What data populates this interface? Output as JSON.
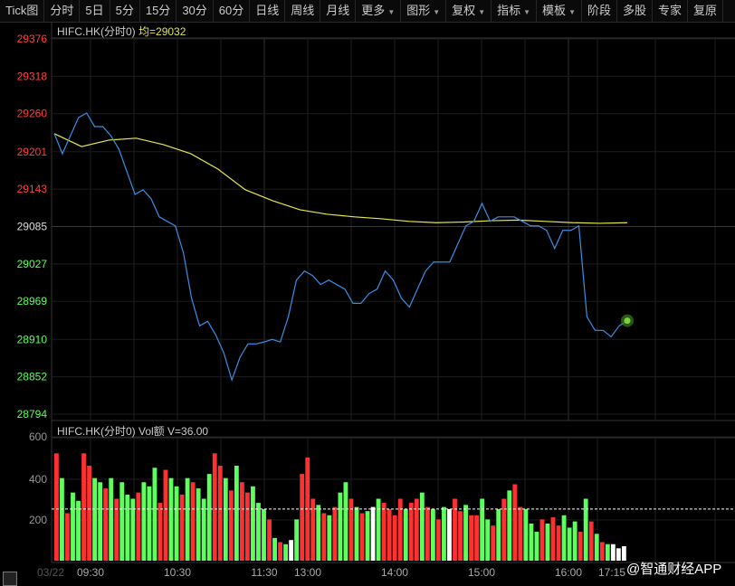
{
  "toolbar": [
    {
      "label": "Tick图",
      "dd": false
    },
    {
      "label": "分时",
      "dd": false
    },
    {
      "label": "5日",
      "dd": false
    },
    {
      "label": "5分",
      "dd": false
    },
    {
      "label": "15分",
      "dd": false
    },
    {
      "label": "30分",
      "dd": false
    },
    {
      "label": "60分",
      "dd": false
    },
    {
      "label": "日线",
      "dd": false
    },
    {
      "label": "周线",
      "dd": false
    },
    {
      "label": "月线",
      "dd": false
    },
    {
      "label": "更多",
      "dd": true
    },
    {
      "label": "图形",
      "dd": true
    },
    {
      "label": "复权",
      "dd": true
    },
    {
      "label": "指标",
      "dd": true
    },
    {
      "label": "模板",
      "dd": true
    },
    {
      "label": "阶段",
      "dd": false
    },
    {
      "label": "多股",
      "dd": false
    },
    {
      "label": "专家",
      "dd": false
    },
    {
      "label": "复原",
      "dd": false
    }
  ],
  "price_panel": {
    "symbol": "HIFC.HK(分时0)",
    "avg_label": "均=29032"
  },
  "volume_panel": {
    "title": "HIFC.HK(分时0) Vol额 V=36.00"
  },
  "watermark": "@智通财经APP",
  "colors": {
    "up": "#ff3030",
    "down": "#5cff5c",
    "price": "#3a8ee6",
    "avg": "#e6e64c",
    "neutral": "#ffffff"
  },
  "chart_data": {
    "type": "line",
    "price_ticks": [
      29376,
      29318,
      29260,
      29201,
      29143,
      29085,
      29027,
      28969,
      28910,
      28852,
      28794
    ],
    "price_ylim": [
      28794,
      29376
    ],
    "baseline": 29085,
    "time_labels": [
      "03/22",
      "09:30",
      "10:30",
      "11:30",
      "13:00",
      "14:00",
      "15:00",
      "16:00",
      "17:15"
    ],
    "price_series": [
      29229,
      29198,
      29226,
      29254,
      29261,
      29240,
      29240,
      29226,
      29205,
      29170,
      29135,
      29142,
      29128,
      29100,
      29093,
      29086,
      29044,
      28974,
      28931,
      28938,
      28917,
      28889,
      28847,
      28882,
      28903,
      28903,
      28906,
      28910,
      28906,
      28945,
      29002,
      29016,
      29009,
      28995,
      29002,
      28995,
      28988,
      28966,
      28966,
      28981,
      28988,
      29016,
      29002,
      28974,
      28960,
      28988,
      29016,
      29030,
      29030,
      29030,
      29058,
      29086,
      29093,
      29121,
      29093,
      29100,
      29100,
      29100,
      29093,
      29086,
      29086,
      29079,
      29051,
      29079,
      29079,
      29086,
      28945,
      28924,
      28924,
      28914,
      28931,
      28939
    ],
    "avg_series": [
      29229,
      29209,
      29219,
      29222,
      29212,
      29198,
      29174,
      29142,
      29125,
      29111,
      29104,
      29100,
      29097,
      29093,
      29091,
      29092,
      29094,
      29095,
      29093,
      29091,
      29090,
      29091
    ],
    "volume_ticks": [
      600,
      400,
      200
    ],
    "volume_ylim": [
      0,
      640
    ],
    "volume_avg": 250,
    "volume": [
      520,
      400,
      230,
      330,
      290,
      520,
      460,
      400,
      380,
      350,
      400,
      300,
      380,
      320,
      300,
      330,
      380,
      360,
      450,
      280,
      440,
      400,
      360,
      320,
      400,
      380,
      350,
      300,
      420,
      520,
      460,
      400,
      340,
      460,
      380,
      330,
      360,
      280,
      250,
      200,
      110,
      90,
      80,
      100,
      200,
      420,
      500,
      300,
      270,
      230,
      220,
      260,
      330,
      380,
      300,
      260,
      230,
      240,
      260,
      300,
      280,
      250,
      220,
      300,
      250,
      280,
      300,
      330,
      260,
      250,
      200,
      260,
      250,
      300,
      240,
      270,
      220,
      220,
      300,
      200,
      170,
      250,
      300,
      340,
      370,
      260,
      250,
      180,
      140,
      200,
      180,
      210,
      170,
      220,
      160,
      190,
      140,
      300,
      190,
      130,
      90,
      80,
      80,
      60,
      70
    ],
    "volume_dir": "rgrggrrggrgrgggrgggrrggrgrgggrrgrgrrgggrgrgwgrrrgrgrggrgrgwgrrrrgrrgrgrgwrrgrrggrgrgrrgggrgrrgggrgrgrg"
  }
}
